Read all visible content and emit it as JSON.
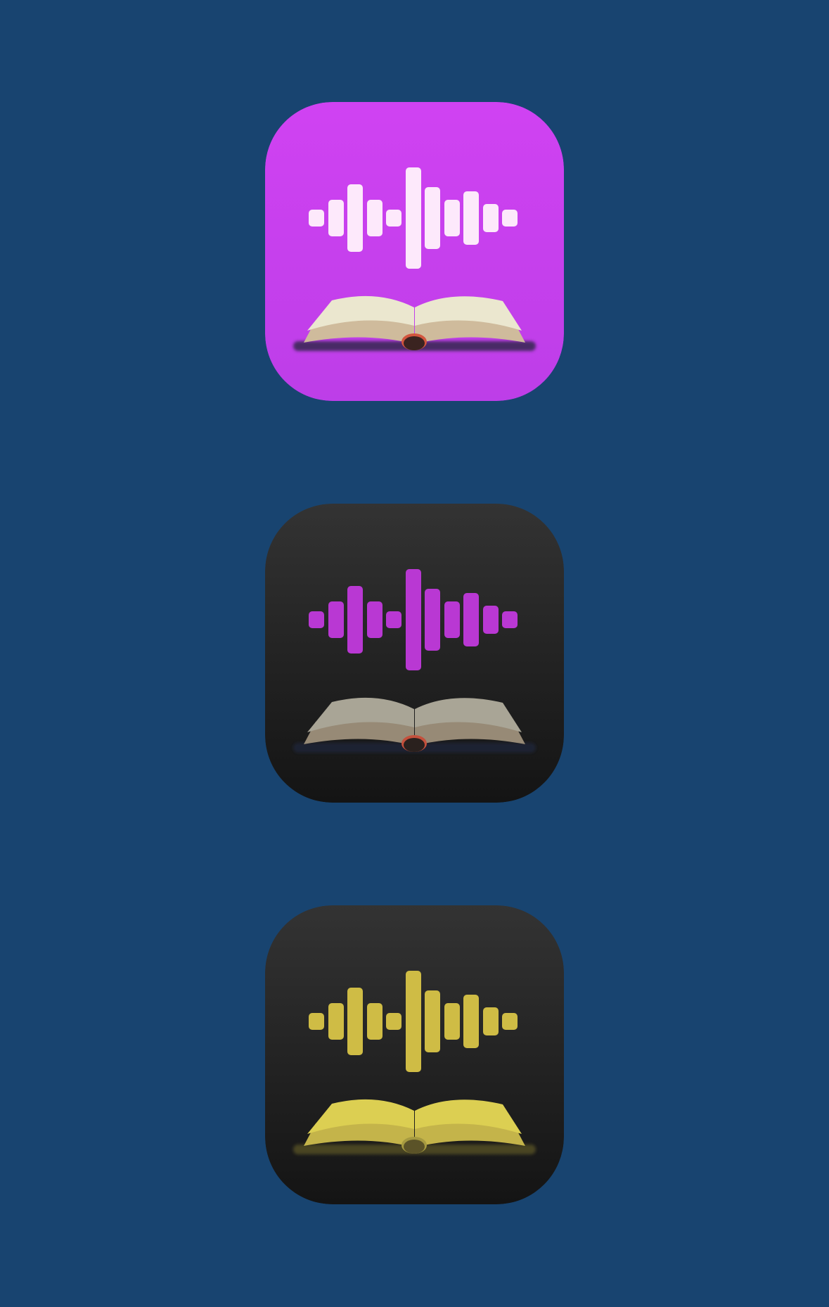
{
  "background_color": "#184470",
  "icons": [
    {
      "name": "light-icon",
      "icon": "waveform-book-icon",
      "bg_top": "#d042f2",
      "bg_bottom": "#bd3ee8",
      "wave_color": "#fde9fb",
      "page_color": "#ebe7cf",
      "page_edge_color": "#cfbb9c",
      "base_color": "#4a2a66",
      "spine_color": "#3a2320",
      "ribbon_color": "#d2553e"
    },
    {
      "name": "dark-icon",
      "icon": "waveform-book-icon",
      "bg_top": "#333333",
      "bg_bottom": "#141414",
      "wave_color": "#b938d3",
      "page_color": "#a9a596",
      "page_edge_color": "#978a76",
      "base_color": "#1f2430",
      "spine_color": "#2a211e",
      "ribbon_color": "#c4503c"
    },
    {
      "name": "tinted-icon",
      "icon": "waveform-book-icon",
      "bg_top": "#333333",
      "bg_bottom": "#141414",
      "wave_color": "#cfbc45",
      "page_color": "#dccf52",
      "page_edge_color": "#c4b44a",
      "base_color": "#4a4424",
      "spine_color": "#5b5328",
      "ribbon_color": "#a69a40"
    }
  ]
}
